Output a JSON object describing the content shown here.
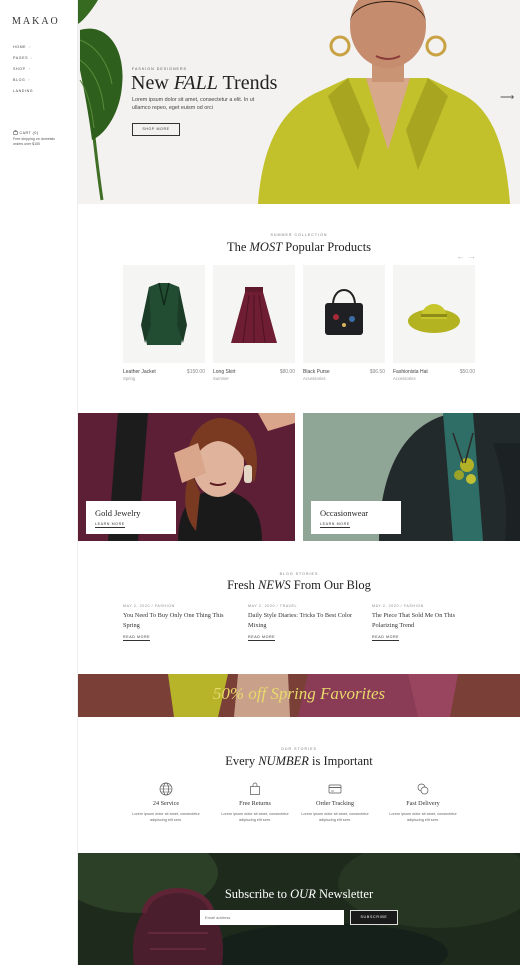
{
  "sidebar": {
    "logo": "MAKAO",
    "nav": [
      {
        "label": "HOME"
      },
      {
        "label": "PAGES"
      },
      {
        "label": "SHOP"
      },
      {
        "label": "BLOG"
      },
      {
        "label": "LANDING"
      }
    ],
    "cart_label": "CART (0)",
    "shipping_note": "Free shipping on domestic orders over $150"
  },
  "hero": {
    "kicker": "FASHION DESIGNERS",
    "title_pre": "New ",
    "title_em": "FALL",
    "title_post": " Trends",
    "text": "Lorem ipsum dolor sit amet, consectetur a elit. In ut ullamco repeo, eget euism od orci",
    "button": "SHOP MORE"
  },
  "products_section": {
    "kicker": "SUMMER COLLECTION",
    "title_pre": "The ",
    "title_em": "MOST",
    "title_post": " Popular Products",
    "items": [
      {
        "name": "Leather Jacket",
        "price": "$150.00",
        "category": "Spring"
      },
      {
        "name": "Long Skirt",
        "price": "$80.00",
        "category": "Summer"
      },
      {
        "name": "Black Purse",
        "price": "$96.50",
        "category": "Accessories"
      },
      {
        "name": "Fashionista Hat",
        "price": "$50.00",
        "category": "Accessories"
      }
    ]
  },
  "categories": [
    {
      "title": "Gold Jewelry",
      "link": "LEARN MORE"
    },
    {
      "title": "Occasionwear",
      "link": "LEARN MORE"
    }
  ],
  "blog": {
    "kicker": "BLOG STORIES",
    "title_pre": "Fresh ",
    "title_em": "NEWS",
    "title_post": " From Our Blog",
    "posts": [
      {
        "meta": "MAY 2, 2020 / FASHION",
        "title": "You Need To Buy Only One Thing This Spring",
        "link": "READ MORE"
      },
      {
        "meta": "MAY 2, 2020 / TRAVEL",
        "title": "Daily Style Diaries: Tricks To Best Color Mixing",
        "link": "READ MORE"
      },
      {
        "meta": "MAY 2, 2020 / FASHION",
        "title": "The Piece That Sold Me On This Polarizing Trend",
        "link": "READ MORE"
      }
    ]
  },
  "promo": {
    "text": "50% off Spring Favorites"
  },
  "stats": {
    "kicker": "OUR STORIES",
    "title_pre": "Every ",
    "title_em": "NUMBER",
    "title_post": " is Important",
    "features": [
      {
        "icon": "globe-icon",
        "title": "24 Service",
        "text": "Lorem ipsum dolor sit amet, consectetur adipiscing elit sem."
      },
      {
        "icon": "bag-icon",
        "title": "Free Returns",
        "text": "Lorem ipsum dolor sit amet, consectetur adipiscing elit sem."
      },
      {
        "icon": "card-icon",
        "title": "Order Tracking",
        "text": "Lorem ipsum dolor sit amet, consectetur adipiscing elit sem."
      },
      {
        "icon": "coins-icon",
        "title": "Fast Delivery",
        "text": "Lorem ipsum dolor sit amet, consectetur adipiscing elit sem."
      }
    ]
  },
  "newsletter": {
    "title_pre": "Subscribe to ",
    "title_em": "OUR",
    "title_post": " Newsletter",
    "placeholder": "Email address",
    "button": "SUBSCRIBE"
  },
  "colors": {
    "hero_bg": "#f3f2f0",
    "jacket_lime": "#c2c02b",
    "wine": "#5c1f35",
    "sage": "#8fa596",
    "promo_bg": "#7a3f36",
    "promo_text": "#e8d96b",
    "newsletter_bg": "#1d2a1c"
  }
}
